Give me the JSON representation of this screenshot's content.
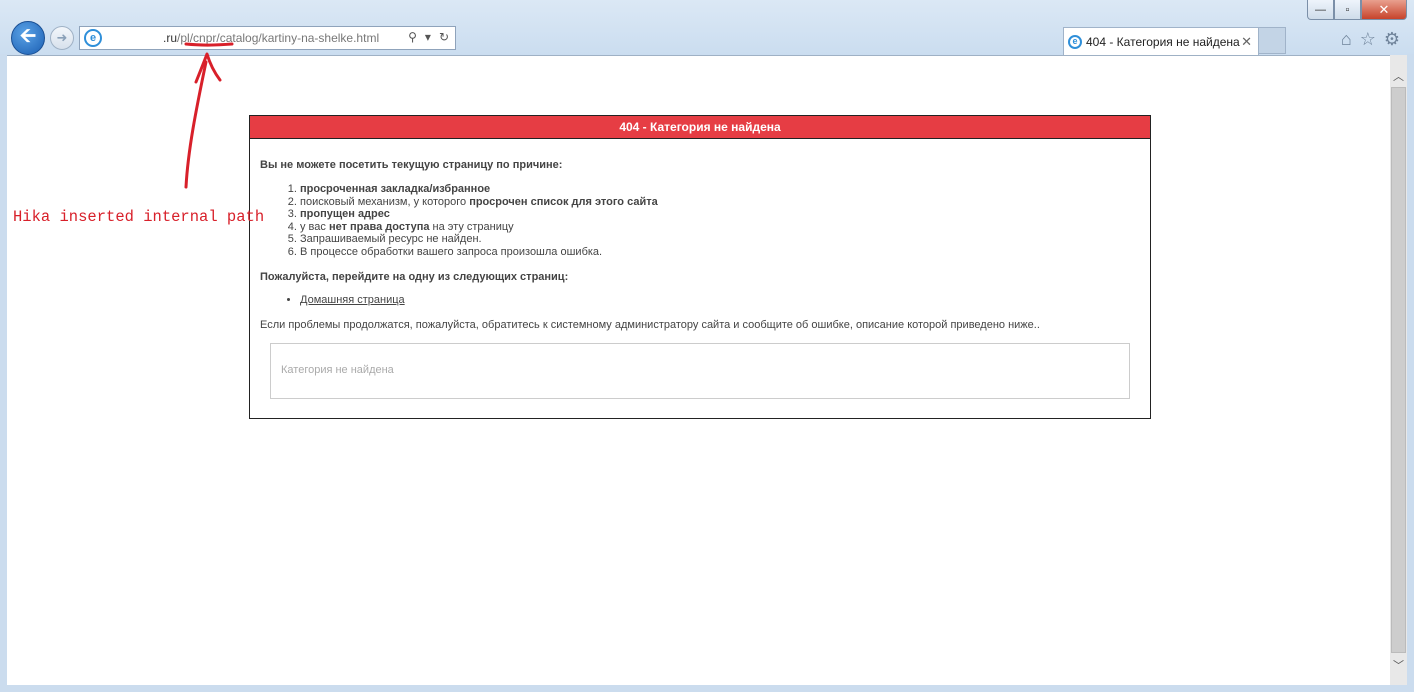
{
  "window": {
    "controls": {
      "minimize": "—",
      "maximize": "▫",
      "close": "✕"
    }
  },
  "nav": {
    "back_icon": "arrow-left-icon",
    "forward_icon": "arrow-right-icon",
    "back_glyph": "🡨",
    "forward_glyph": "➜"
  },
  "address_bar": {
    "url_visible": ".ru/pl/cnpr/catalog/kartiny-na-shelke.html",
    "url_prefix": ".ru",
    "url_rest": "/pl/cnpr/catalog/kartiny-na-shelke.html",
    "tools": [
      "search-icon",
      "dropdown-icon",
      "refresh-icon"
    ],
    "tool_glyphs": [
      "⚲",
      "▾",
      "↻"
    ]
  },
  "tab": {
    "title": "404 - Категория не найдена",
    "close_glyph": "✕"
  },
  "toolbar_icons": {
    "home": "⌂",
    "favorites": "☆",
    "settings": "⚙"
  },
  "error": {
    "header": "404 - Категория не найдена",
    "intro": "Вы не можете посетить текущую страницу по причине:",
    "reasons": [
      {
        "bold": "просроченная закладка/избранное",
        "plain": ""
      },
      {
        "pre": "поисковый механизм, у которого ",
        "bold": "просрочен список для этого сайта",
        "plain": ""
      },
      {
        "bold": "пропущен адрес",
        "plain": ""
      },
      {
        "pre": "у вас ",
        "bold": "нет права доступа",
        "plain": " на эту страницу"
      },
      {
        "plain": "Запрашиваемый ресурс не найден."
      },
      {
        "plain": "В процессе обработки вашего запроса произошла ошибка."
      }
    ],
    "goto": "Пожалуйста, перейдите на одну из следующих страниц:",
    "home_link": "Домашняя страница",
    "persist": "Если проблемы продолжатся, пожалуйста, обратитесь к системному администратору сайта и сообщите об ошибке, описание которой приведено ниже..",
    "detail": "Категория не найдена"
  },
  "annotation": {
    "text": "Hika inserted internal path",
    "color": "#d8202a"
  },
  "colors": {
    "header_red": "#e63d44",
    "frame": "#cbdcee"
  }
}
